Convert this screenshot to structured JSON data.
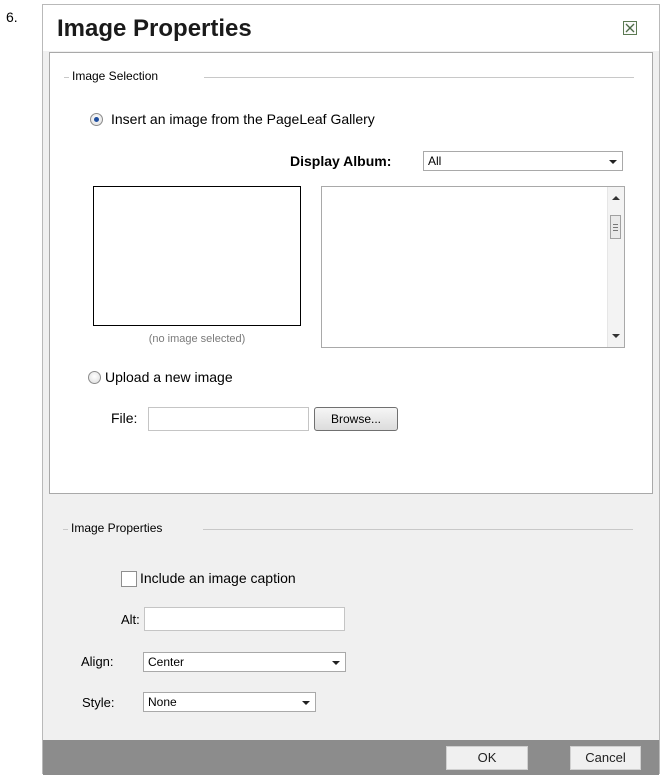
{
  "step_number": "6.",
  "dialog": {
    "title": "Image Properties"
  },
  "image_selection": {
    "group_label": "Image Selection",
    "gallery_radio_label": "Insert an image from the PageLeaf Gallery",
    "gallery_radio_checked": true,
    "display_album_label": "Display Album:",
    "display_album_value": "All",
    "no_image_text": "(no image selected)",
    "upload_radio_label": "Upload a new image",
    "upload_radio_checked": false,
    "file_label": "File:",
    "file_value": "",
    "browse_label": "Browse..."
  },
  "image_properties": {
    "group_label": "Image Properties",
    "caption_checkbox_label": "Include an image caption",
    "caption_checked": false,
    "alt_label": "Alt:",
    "alt_value": "",
    "align_label": "Align:",
    "align_value": "Center",
    "style_label": "Style:",
    "style_value": "None"
  },
  "footer": {
    "ok_label": "OK",
    "cancel_label": "Cancel"
  }
}
